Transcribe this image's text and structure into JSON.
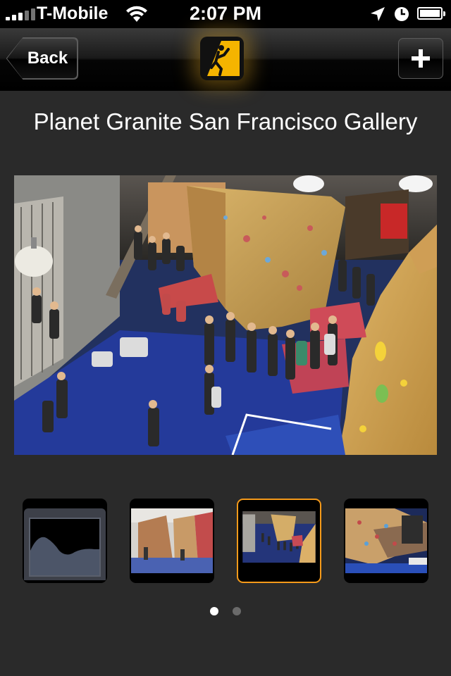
{
  "status": {
    "carrier": "T-Mobile",
    "time": "2:07 PM",
    "icons": [
      "signal-icon",
      "wifi-icon",
      "location-icon",
      "alarm-icon",
      "battery-icon"
    ]
  },
  "nav": {
    "back_label": "Back",
    "add_icon": "plus-icon",
    "logo_icon": "climber-logo-icon",
    "accent_color": "#f5b400"
  },
  "gallery": {
    "title": "Planet Granite San Francisco Gallery",
    "main_photo": "climbing-gym-bouldering-area",
    "thumbnails": [
      {
        "name": "placeholder-image",
        "selected": false
      },
      {
        "name": "climbing-walls-photo",
        "selected": false
      },
      {
        "name": "bouldering-crowd-photo",
        "selected": true
      },
      {
        "name": "overhang-wall-photo",
        "selected": false
      }
    ],
    "selected_color": "#f59a1a"
  },
  "pagination": {
    "pages": 2,
    "current": 1
  }
}
